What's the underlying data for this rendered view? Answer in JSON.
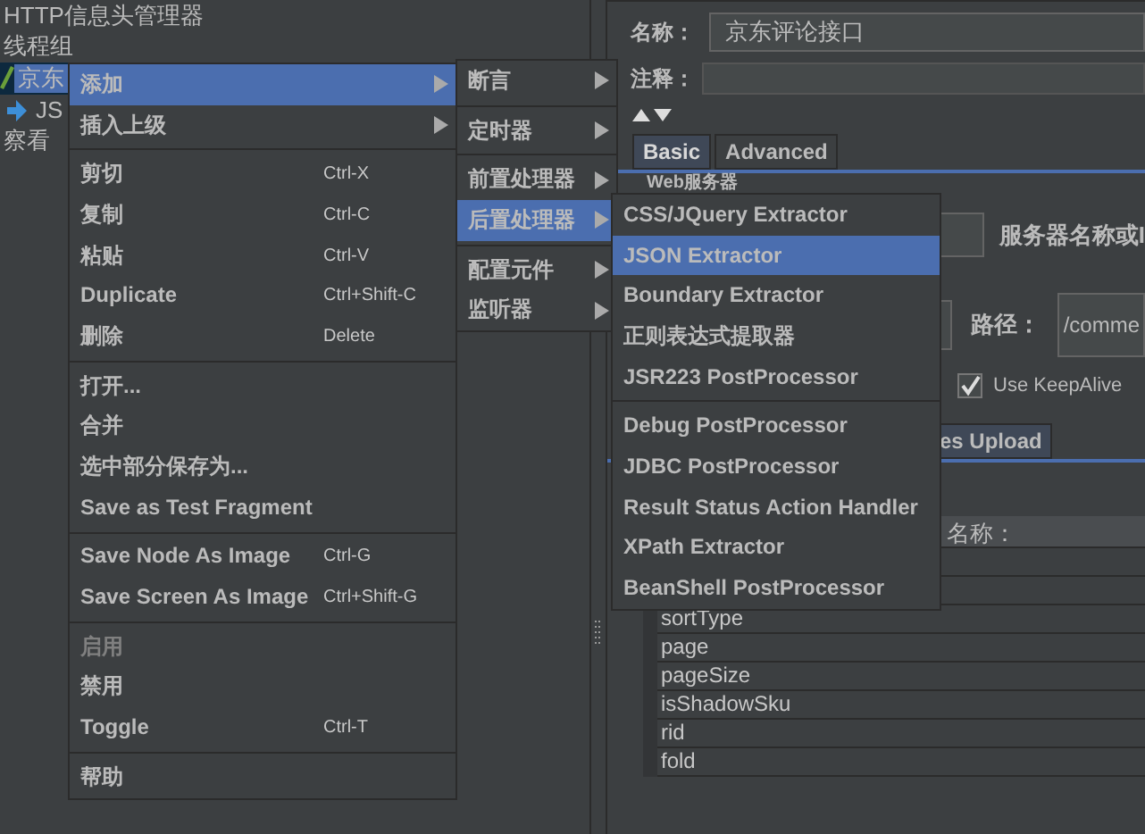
{
  "tree": {
    "items": [
      {
        "label": "HTTP信息头管理器",
        "kind": "plain",
        "selected": false
      },
      {
        "label": "线程组",
        "kind": "plain",
        "selected": false
      },
      {
        "label": "京东",
        "kind": "sampler",
        "selected": true
      },
      {
        "label": "JS",
        "kind": "extractor",
        "selected": false
      },
      {
        "label": "察看",
        "kind": "plain",
        "selected": false
      }
    ]
  },
  "context_menu": {
    "items": [
      {
        "kind": "item",
        "label": "添加",
        "submenu": true,
        "selected": true,
        "disabled": false
      },
      {
        "kind": "item",
        "label": "插入上级",
        "submenu": true,
        "selected": false,
        "disabled": false
      },
      {
        "kind": "separator"
      },
      {
        "kind": "item",
        "label": "剪切",
        "shortcut": "Ctrl-X",
        "selected": false,
        "disabled": false
      },
      {
        "kind": "item",
        "label": "复制",
        "shortcut": "Ctrl-C",
        "selected": false,
        "disabled": false
      },
      {
        "kind": "item",
        "label": "粘贴",
        "shortcut": "Ctrl-V",
        "selected": false,
        "disabled": false
      },
      {
        "kind": "item",
        "label": "Duplicate",
        "shortcut": "Ctrl+Shift-C",
        "selected": false,
        "disabled": false
      },
      {
        "kind": "item",
        "label": "删除",
        "shortcut": "Delete",
        "selected": false,
        "disabled": false
      },
      {
        "kind": "separator"
      },
      {
        "kind": "item",
        "label": "打开...",
        "selected": false,
        "disabled": false
      },
      {
        "kind": "item",
        "label": "合并",
        "selected": false,
        "disabled": false
      },
      {
        "kind": "item",
        "label": "选中部分保存为...",
        "selected": false,
        "disabled": false
      },
      {
        "kind": "item",
        "label": "Save as Test Fragment",
        "selected": false,
        "disabled": false
      },
      {
        "kind": "separator"
      },
      {
        "kind": "item",
        "label": "Save Node As Image",
        "shortcut": "Ctrl-G",
        "selected": false,
        "disabled": false
      },
      {
        "kind": "item",
        "label": "Save Screen As Image",
        "shortcut": "Ctrl+Shift-G",
        "selected": false,
        "disabled": false
      },
      {
        "kind": "separator"
      },
      {
        "kind": "item",
        "label": "启用",
        "selected": false,
        "disabled": true
      },
      {
        "kind": "item",
        "label": "禁用",
        "selected": false,
        "disabled": false
      },
      {
        "kind": "item",
        "label": "Toggle",
        "shortcut": "Ctrl-T",
        "selected": false,
        "disabled": false
      },
      {
        "kind": "separator"
      },
      {
        "kind": "item",
        "label": "帮助",
        "selected": false,
        "disabled": false
      }
    ]
  },
  "add_submenu": {
    "items": [
      {
        "kind": "item",
        "label": "断言",
        "submenu": true,
        "selected": false
      },
      {
        "kind": "separator"
      },
      {
        "kind": "item",
        "label": "定时器",
        "submenu": true,
        "selected": false
      },
      {
        "kind": "separator"
      },
      {
        "kind": "item",
        "label": "前置处理器",
        "submenu": true,
        "selected": false
      },
      {
        "kind": "item",
        "label": "后置处理器",
        "submenu": true,
        "selected": true
      },
      {
        "kind": "separator"
      },
      {
        "kind": "item",
        "label": "配置元件",
        "submenu": true,
        "selected": false
      },
      {
        "kind": "item",
        "label": "监听器",
        "submenu": true,
        "selected": false
      }
    ]
  },
  "post_processor_submenu": {
    "items": [
      {
        "kind": "item",
        "label": "CSS/JQuery Extractor",
        "selected": false
      },
      {
        "kind": "item",
        "label": "JSON Extractor",
        "selected": true
      },
      {
        "kind": "item",
        "label": "Boundary Extractor",
        "selected": false
      },
      {
        "kind": "item",
        "label": "正则表达式提取器",
        "selected": false
      },
      {
        "kind": "item",
        "label": "JSR223 PostProcessor",
        "selected": false
      },
      {
        "kind": "separator"
      },
      {
        "kind": "item",
        "label": "Debug PostProcessor",
        "selected": false
      },
      {
        "kind": "item",
        "label": "JDBC PostProcessor",
        "selected": false
      },
      {
        "kind": "item",
        "label": "Result Status Action Handler",
        "selected": false
      },
      {
        "kind": "item",
        "label": "XPath Extractor",
        "selected": false
      },
      {
        "kind": "item",
        "label": "BeanShell PostProcessor",
        "selected": false
      }
    ]
  },
  "editor": {
    "name_label": "名称：",
    "name_value": "京东评论接口",
    "comment_label": "注释：",
    "tabs": [
      {
        "label": "Basic",
        "selected": true
      },
      {
        "label": "Advanced",
        "selected": false
      }
    ],
    "group_title": "Web服务器",
    "server_label": "服务器名称或I",
    "path_label": "路径：",
    "path_value": "/comme",
    "keepalive": {
      "label": "Use KeepAlive",
      "checked": true
    },
    "lower_tab": {
      "label": "es Upload",
      "selected": true
    },
    "table": {
      "columns": [
        "名称："
      ],
      "rows": [
        [
          "sortType"
        ],
        [
          "page"
        ],
        [
          "pageSize"
        ],
        [
          "isShadowSku"
        ],
        [
          "rid"
        ],
        [
          "fold"
        ]
      ]
    }
  }
}
